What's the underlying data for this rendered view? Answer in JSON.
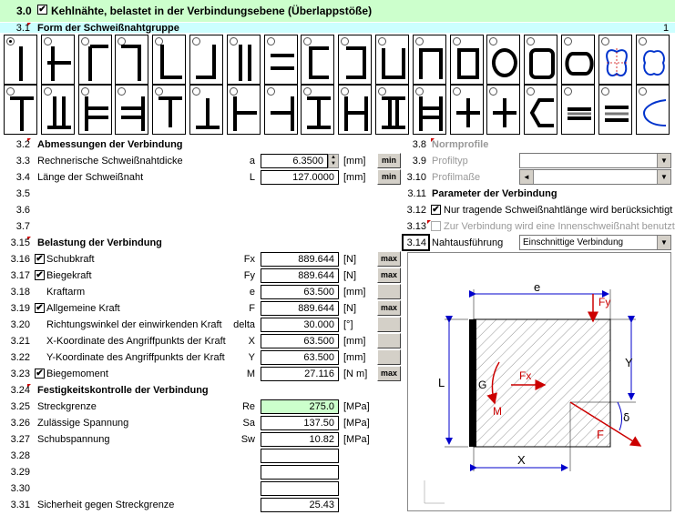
{
  "header": {
    "number": "3.0",
    "title": "Kehlnähte, belastet in der Verbindungsebene (Überlappstöße)"
  },
  "form": {
    "number": "3.1",
    "title": "Form der Schweißnahtgruppe",
    "page": "1"
  },
  "dims": {
    "s32": {
      "num": "3.2",
      "title": "Abmessungen der Verbindung"
    },
    "r33": {
      "num": "3.3",
      "label": "Rechnerische Schweißnahtdicke",
      "sym": "a",
      "value": "6.3500",
      "unit": "[mm]",
      "btn": "min"
    },
    "r34": {
      "num": "3.4",
      "label": "Länge der Schweißnaht",
      "sym": "L",
      "value": "127.0000",
      "unit": "[mm]",
      "btn": "min"
    },
    "r35": {
      "num": "3.5"
    },
    "r36": {
      "num": "3.6"
    },
    "r37": {
      "num": "3.7"
    }
  },
  "norm": {
    "r38": {
      "num": "3.8",
      "title": "Normprofile"
    },
    "r39": {
      "num": "3.9",
      "label": "Profiltyp"
    },
    "r310": {
      "num": "3.10",
      "label": "Profilmaße"
    }
  },
  "params": {
    "r311": {
      "num": "3.11",
      "title": "Parameter der Verbindung"
    },
    "r312": {
      "num": "3.12",
      "label": "Nur tragende Schweißnahtlänge wird berücksichtigt"
    },
    "r313": {
      "num": "3.13",
      "label": "Zur Verbindung wird eine Innenschweißnaht benutzt"
    },
    "r314": {
      "num": "3.14",
      "label": "Nahtausführung",
      "value": "Einschnittige Verbindung"
    }
  },
  "load": {
    "s315": {
      "num": "3.15",
      "title": "Belastung der Verbindung"
    },
    "rows": [
      {
        "num": "3.16",
        "label": "Schubkraft",
        "check": true,
        "sym": "Fx",
        "value": "889.644",
        "unit": "[N]",
        "btn": "max"
      },
      {
        "num": "3.17",
        "label": "Biegekraft",
        "check": true,
        "sym": "Fy",
        "value": "889.644",
        "unit": "[N]",
        "btn": "max"
      },
      {
        "num": "3.18",
        "label": "Kraftarm",
        "check": false,
        "sym": "e",
        "value": "63.500",
        "unit": "[mm]",
        "btn": ""
      },
      {
        "num": "3.19",
        "label": "Allgemeine Kraft",
        "check": true,
        "sym": "F",
        "value": "889.644",
        "unit": "[N]",
        "btn": "max"
      },
      {
        "num": "3.20",
        "label": "Richtungswinkel der einwirkenden Kraft",
        "check": false,
        "sym": "delta",
        "value": "30.000",
        "unit": "[°]",
        "btn": ""
      },
      {
        "num": "3.21",
        "label": "X-Koordinate des Angriffpunkts der Kraft",
        "check": false,
        "sym": "X",
        "value": "63.500",
        "unit": "[mm]",
        "btn": ""
      },
      {
        "num": "3.22",
        "label": "Y-Koordinate des Angriffpunkts der Kraft",
        "check": false,
        "sym": "Y",
        "value": "63.500",
        "unit": "[mm]",
        "btn": ""
      },
      {
        "num": "3.23",
        "label": "Biegemoment",
        "check": true,
        "sym": "M",
        "value": "27.116",
        "unit": "[N m]",
        "btn": "max"
      }
    ]
  },
  "strength": {
    "s324": {
      "num": "3.24",
      "title": "Festigkeitskontrolle der Verbindung"
    },
    "rows": [
      {
        "num": "3.25",
        "label": "Streckgrenze",
        "sym": "Re",
        "value": "275.0",
        "unit": "[MPa]"
      },
      {
        "num": "3.26",
        "label": "Zulässige Spannung",
        "sym": "Sa",
        "value": "137.50",
        "unit": "[MPa]"
      },
      {
        "num": "3.27",
        "label": "Schubspannung",
        "sym": "Sw",
        "value": "10.82",
        "unit": "[MPa]"
      }
    ],
    "r328": {
      "num": "3.28"
    },
    "r329": {
      "num": "3.29"
    },
    "r330": {
      "num": "3.30"
    },
    "r331": {
      "num": "3.31",
      "label": "Sicherheit gegen Streckgrenze",
      "value": "25.43"
    }
  },
  "diagram": {
    "e": "e",
    "Fy": "Fy",
    "Fx": "Fx",
    "L": "L",
    "G": "G",
    "M": "M",
    "Y": "Y",
    "X": "X",
    "F": "F",
    "delta": "δ"
  },
  "icons": {
    "check": "✔",
    "arrow_down": "▼",
    "arrow_up": "▲",
    "arrow_left": "◄"
  }
}
